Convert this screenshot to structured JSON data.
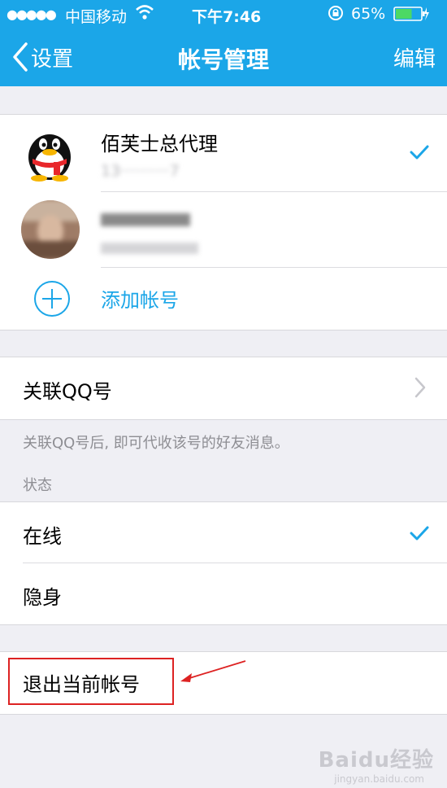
{
  "status_bar": {
    "signal": "●●●●●",
    "carrier": "中国移动",
    "time": "下午7:46",
    "battery_percent": "65%",
    "battery_level": 0.65
  },
  "nav": {
    "back_label": "设置",
    "title": "帐号管理",
    "edit_label": "编辑"
  },
  "accounts": [
    {
      "name": "佰芙士总代理",
      "phone": "13··········7",
      "selected": true
    },
    {
      "name": "",
      "phone": "",
      "selected": false
    }
  ],
  "add_account_label": "添加帐号",
  "link_qq": {
    "label": "关联QQ号",
    "note": "关联QQ号后, 即可代收该号的好友消息。"
  },
  "status_section": {
    "header": "状态",
    "options": [
      {
        "label": "在线",
        "selected": true
      },
      {
        "label": "隐身",
        "selected": false
      }
    ]
  },
  "logout_label": "退出当前帐号",
  "colors": {
    "accent": "#1ba6e8",
    "annotation": "#dd2222"
  },
  "watermark": {
    "brand": "Baidu经验",
    "url": "jingyan.baidu.com"
  }
}
